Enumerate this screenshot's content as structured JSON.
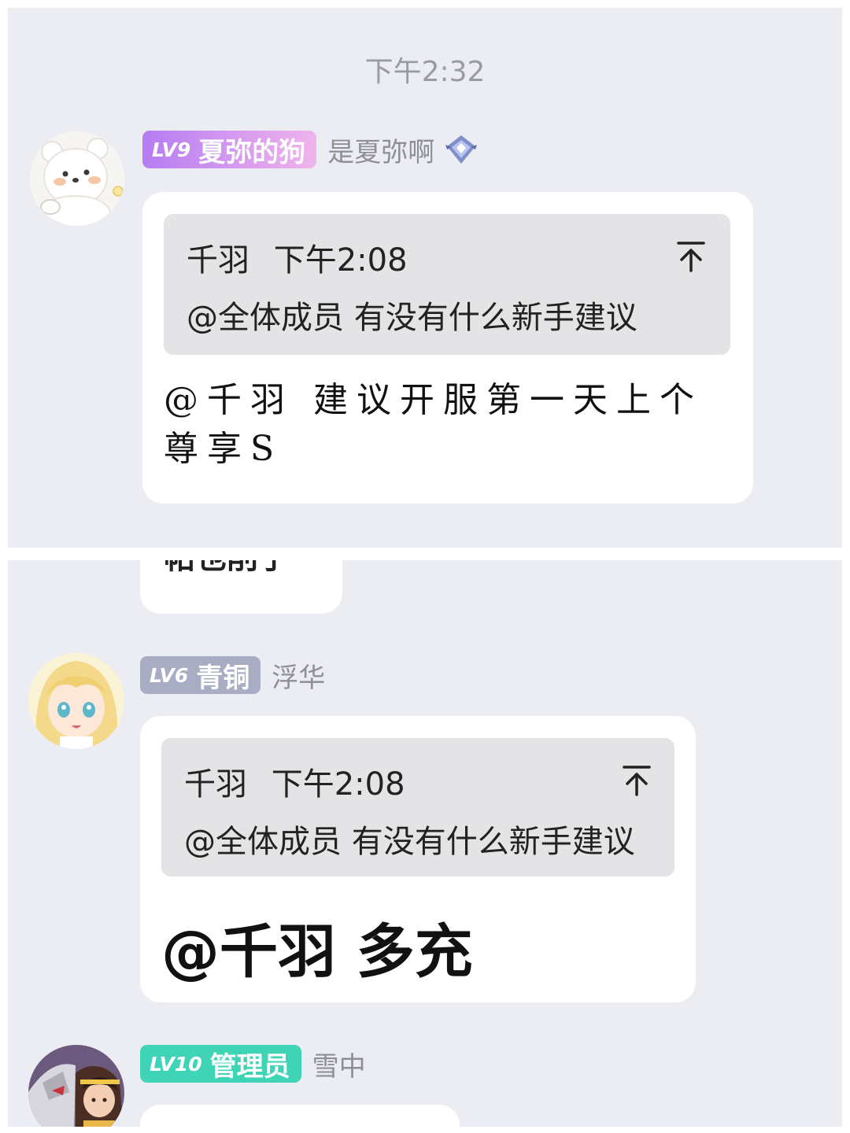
{
  "top_panel": {
    "timestamp": "下午2:32",
    "message": {
      "level": "LV9",
      "title": "夏弥的狗",
      "username": "是夏弥啊",
      "vip_icon": "diamond-badge-icon",
      "avatar_icon": "polar-bear-avatar-icon",
      "quote": {
        "author": "千羽",
        "time": "下午2:08",
        "text": "@全体成员 有没有什么新手建议",
        "pin_icon": "jump-to-top-icon"
      },
      "reply": "@千羽 建议开服第一天上个尊享S"
    }
  },
  "bottom_panel": {
    "partial_message_text": "帕也削了",
    "message_1": {
      "level": "LV6",
      "title": "青铜",
      "username": "浮华",
      "avatar_icon": "anime-girl-avatar-icon",
      "quote": {
        "author": "千羽",
        "time": "下午2:08",
        "text": "@全体成员 有没有什么新手建议",
        "pin_icon": "jump-to-top-icon"
      },
      "reply": "@千羽 多充"
    },
    "message_2": {
      "level": "LV10",
      "title": "管理员",
      "username": "雪中",
      "avatar_icon": "mecha-character-avatar-icon"
    }
  },
  "colors": {
    "background": "#ecedf2",
    "bubble": "#ffffff",
    "quote_background": "#e4e4e7",
    "lv9_badge_gradient": [
      "#b67cf3",
      "#f0b4ec"
    ],
    "lv6_badge": "#a8adc4",
    "lv10_badge": "#3fd4b6",
    "secondary_text": "#8e8f96"
  }
}
